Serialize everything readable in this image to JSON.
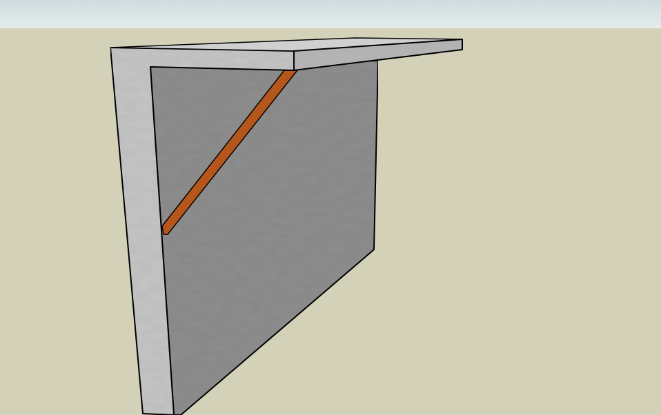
{
  "viewport": {
    "sky_color": "#dbe5e6",
    "ground_color": "#d3d2b9",
    "model": {
      "frame_color": "#c6c6c6",
      "back_panel_color": "#8f8f8f",
      "slab_side_color": "#b3b3b3",
      "slab_top_color": "#d0d0d0",
      "brace_color": "#b5561c",
      "edge_color": "#000000",
      "parts": [
        "wall-frame",
        "back-panel",
        "top-slab",
        "diagonal-brace"
      ]
    }
  }
}
